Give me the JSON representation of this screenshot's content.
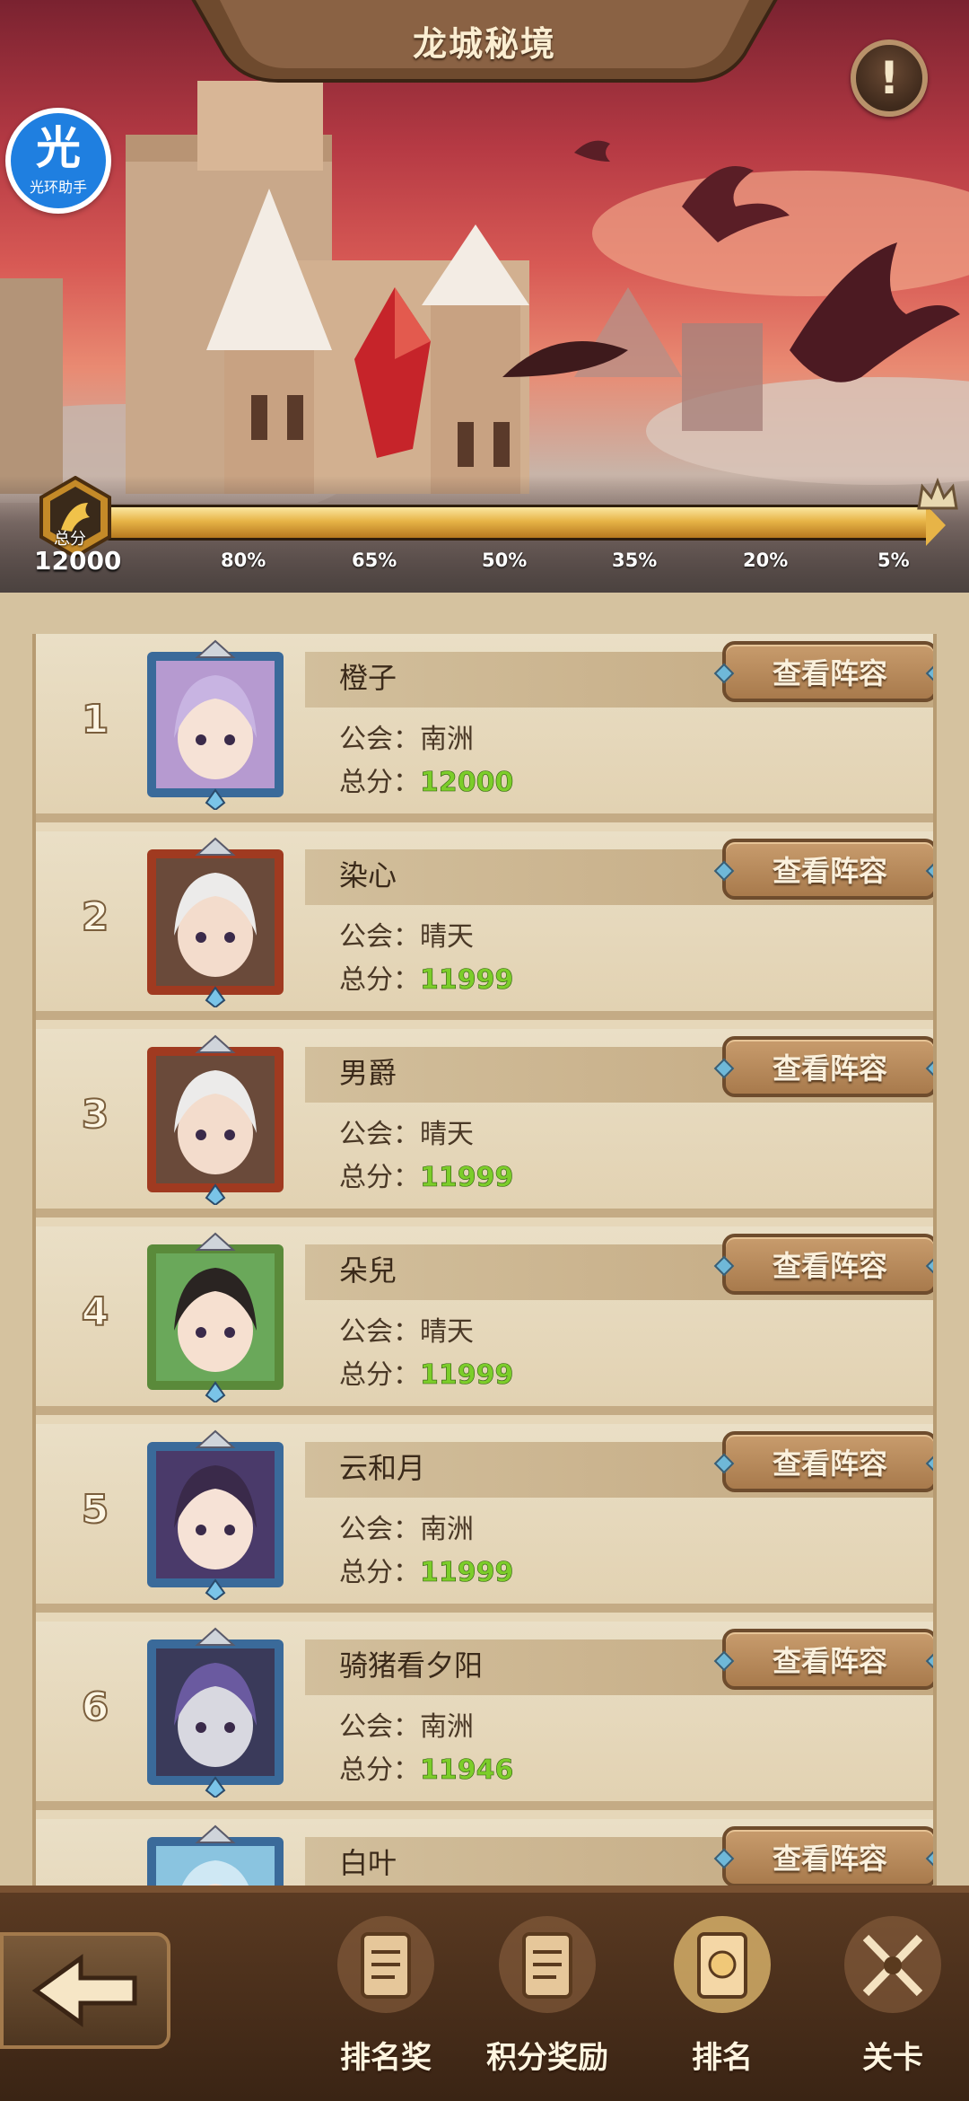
{
  "header": {
    "title": "龙城秘境",
    "info_label": "!",
    "helper": {
      "glyph": "光",
      "label": "光环助手"
    }
  },
  "progress": {
    "medal_label": "总分",
    "total_score": "12000",
    "fill_fraction": 1.0,
    "percent_marks": [
      "80%",
      "65%",
      "50%",
      "35%",
      "20%",
      "5%"
    ]
  },
  "colors": {
    "score_green": "#7ccd2a",
    "button_brown": "#a87a4c",
    "banner_red": "#b63a44"
  },
  "entries": [
    {
      "rank": "1",
      "name": "橙子",
      "guild_label": "公会：",
      "guild": "南洲",
      "score_label": "总分：",
      "score": "12000",
      "button": "查看阵容",
      "avatar": "purple-haired-vampire-avatar-icon"
    },
    {
      "rank": "2",
      "name": "染心",
      "guild_label": "公会：",
      "guild": "晴天",
      "score_label": "总分：",
      "score": "11999",
      "button": "查看阵容",
      "avatar": "masked-white-haired-avatar-icon"
    },
    {
      "rank": "3",
      "name": "男爵",
      "guild_label": "公会：",
      "guild": "晴天",
      "score_label": "总分：",
      "score": "11999",
      "button": "查看阵容",
      "avatar": "masked-white-haired-avatar-icon"
    },
    {
      "rank": "4",
      "name": "朵兒",
      "guild_label": "公会：",
      "guild": "晴天",
      "score_label": "总分：",
      "score": "11999",
      "button": "查看阵容",
      "avatar": "flower-frame-girl-avatar-icon"
    },
    {
      "rank": "5",
      "name": "云和月",
      "guild_label": "公会：",
      "guild": "南洲",
      "score_label": "总分：",
      "score": "11999",
      "button": "查看阵容",
      "avatar": "horned-elf-avatar-icon"
    },
    {
      "rank": "6",
      "name": "骑猪看夕阳",
      "guild_label": "公会：",
      "guild": "南洲",
      "score_label": "总分：",
      "score": "11946",
      "button": "查看阵容",
      "avatar": "skull-knight-avatar-icon"
    },
    {
      "rank": "",
      "name": "白叶",
      "guild_label": "",
      "guild": "",
      "score_label": "",
      "score": "",
      "button": "查看阵容",
      "avatar": "blue-crown-avatar-icon"
    }
  ],
  "nav": {
    "back_icon": "back-arrow-icon",
    "tabs": [
      {
        "label": "排名奖",
        "icon": "rank-reward-scroll-icon"
      },
      {
        "label": "积分奖励",
        "icon": "points-reward-scroll-icon"
      },
      {
        "label": "排名",
        "icon": "ranking-scroll-icon",
        "active": true
      },
      {
        "label": "关卡",
        "icon": "stage-crossed-swords-icon"
      }
    ]
  }
}
